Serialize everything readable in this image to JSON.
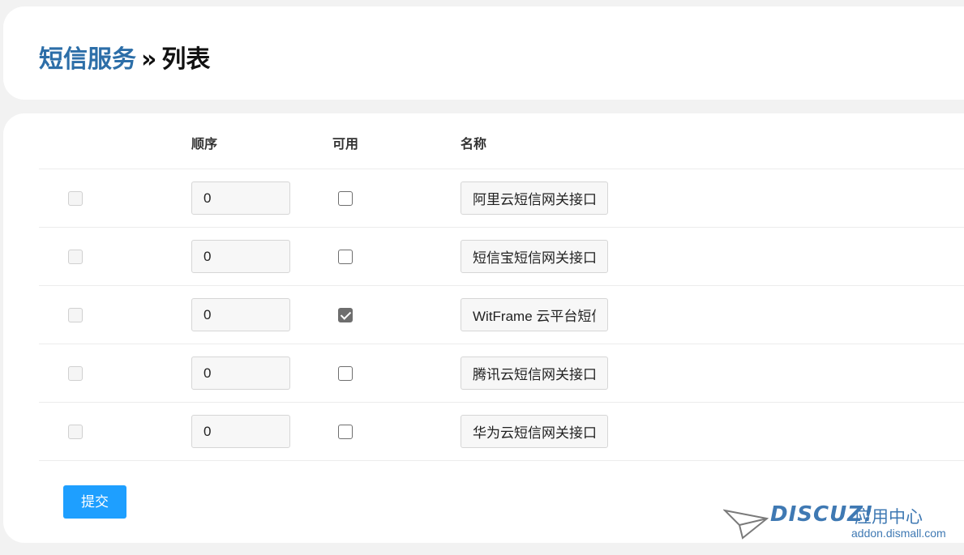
{
  "header": {
    "breadcrumb_link": "短信服务",
    "separator": "»",
    "current": "列表"
  },
  "table": {
    "columns": [
      "",
      "顺序",
      "可用",
      "名称"
    ],
    "rows": [
      {
        "order": "0",
        "available": false,
        "name": "阿里云短信网关接口"
      },
      {
        "order": "0",
        "available": false,
        "name": "短信宝短信网关接口"
      },
      {
        "order": "0",
        "available": true,
        "name": "WitFrame 云平台短信网关接口"
      },
      {
        "order": "0",
        "available": false,
        "name": "腾讯云短信网关接口"
      },
      {
        "order": "0",
        "available": false,
        "name": "华为云短信网关接口"
      }
    ]
  },
  "submit_label": "提交",
  "watermark": {
    "brand": "DISCUZ!",
    "center": "应用中心",
    "url": "addon.dismall.com"
  },
  "colors": {
    "breadcrumb": "#2c6ea8",
    "primary_button": "#1e9fff",
    "watermark": "#3f79b3"
  }
}
